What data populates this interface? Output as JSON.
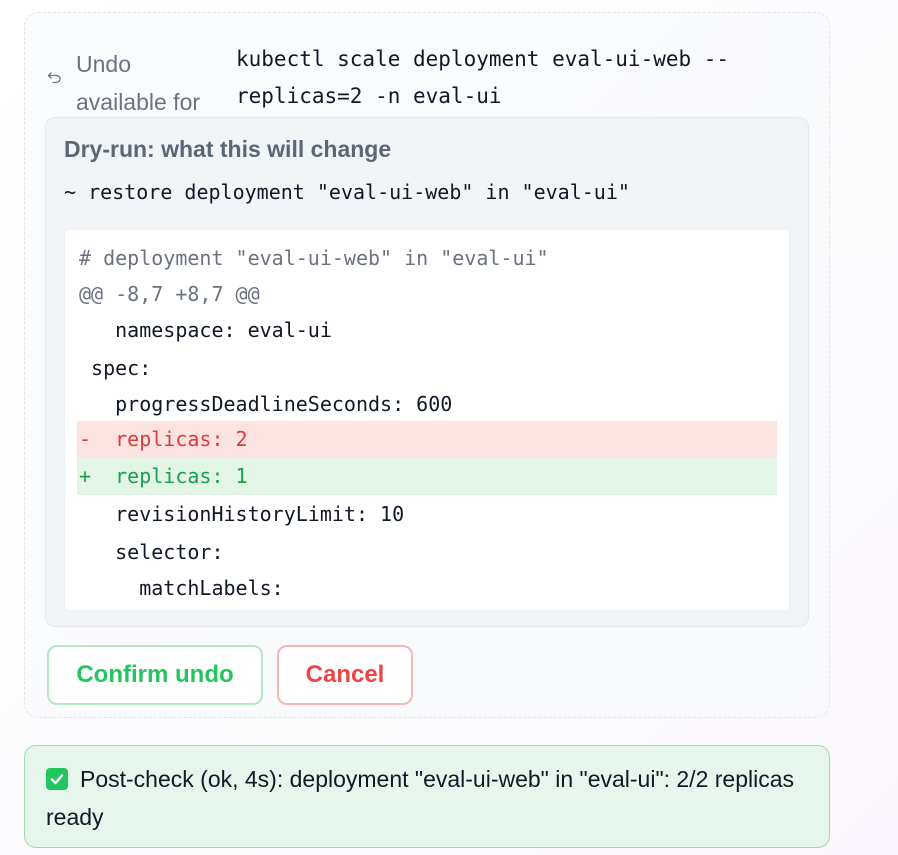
{
  "undo": {
    "label_line1": "Undo",
    "label_line2": "available for",
    "command_line1": "kubectl scale deployment eval-ui-web --",
    "command_line2": "replicas=2 -n eval-ui"
  },
  "dry_run": {
    "title": "Dry-run: what this will change",
    "summary": "~ restore deployment \"eval-ui-web\" in \"eval-ui\"",
    "diff_lines": [
      {
        "kind": "comment",
        "text": "# deployment \"eval-ui-web\" in \"eval-ui\""
      },
      {
        "kind": "hunk",
        "text": "@@ -8,7 +8,7 @@"
      },
      {
        "kind": "context",
        "text": "   namespace: eval-ui"
      },
      {
        "kind": "context",
        "text": " spec:"
      },
      {
        "kind": "context",
        "text": "   progressDeadlineSeconds: 600"
      },
      {
        "kind": "del",
        "text": "-  replicas: 2"
      },
      {
        "kind": "add",
        "text": "+  replicas: 1"
      },
      {
        "kind": "context",
        "text": "   revisionHistoryLimit: 10"
      },
      {
        "kind": "context",
        "text": "   selector:"
      },
      {
        "kind": "context",
        "text": "     matchLabels:"
      }
    ]
  },
  "buttons": {
    "confirm_label": "Confirm undo",
    "cancel_label": "Cancel"
  },
  "post_check": {
    "icon": "check-mark-button",
    "text": "Post-check (ok, 4s): deployment \"eval-ui-web\" in \"eval-ui\": 2/2 replicas ready"
  },
  "colors": {
    "success": "#22c55e",
    "danger": "#ef4444",
    "diff_add_bg": "#e2f5e7",
    "diff_del_bg": "#fbe3e1"
  }
}
